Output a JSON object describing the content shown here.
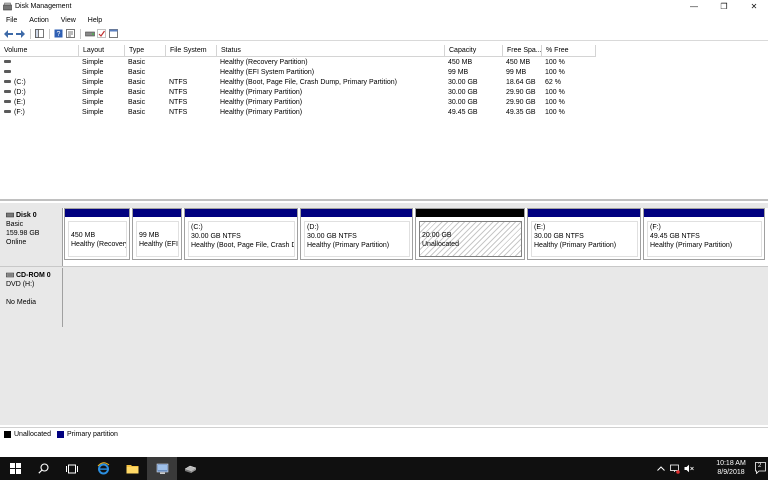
{
  "window": {
    "title": "Disk Management",
    "controls": {
      "minimize": "—",
      "restore": "❐",
      "close": "✕"
    }
  },
  "menu": [
    "File",
    "Action",
    "View",
    "Help"
  ],
  "volume_table": {
    "columns": [
      "Volume",
      "Layout",
      "Type",
      "File System",
      "Status",
      "Capacity",
      "Free Spa...",
      "% Free"
    ],
    "rows": [
      {
        "volume": "",
        "layout": "Simple",
        "type": "Basic",
        "fs": "",
        "status": "Healthy (Recovery Partition)",
        "capacity": "450 MB",
        "free": "450 MB",
        "pct": "100 %"
      },
      {
        "volume": "",
        "layout": "Simple",
        "type": "Basic",
        "fs": "",
        "status": "Healthy (EFI System Partition)",
        "capacity": "99 MB",
        "free": "99 MB",
        "pct": "100 %"
      },
      {
        "volume": "(C:)",
        "layout": "Simple",
        "type": "Basic",
        "fs": "NTFS",
        "status": "Healthy (Boot, Page File, Crash Dump, Primary Partition)",
        "capacity": "30.00 GB",
        "free": "18.64 GB",
        "pct": "62 %"
      },
      {
        "volume": "(D:)",
        "layout": "Simple",
        "type": "Basic",
        "fs": "NTFS",
        "status": "Healthy (Primary Partition)",
        "capacity": "30.00 GB",
        "free": "29.90 GB",
        "pct": "100 %"
      },
      {
        "volume": "(E:)",
        "layout": "Simple",
        "type": "Basic",
        "fs": "NTFS",
        "status": "Healthy (Primary Partition)",
        "capacity": "30.00 GB",
        "free": "29.90 GB",
        "pct": "100 %"
      },
      {
        "volume": "(F:)",
        "layout": "Simple",
        "type": "Basic",
        "fs": "NTFS",
        "status": "Healthy (Primary Partition)",
        "capacity": "49.45 GB",
        "free": "49.35 GB",
        "pct": "100 %"
      }
    ]
  },
  "disk0": {
    "name": "Disk 0",
    "type": "Basic",
    "size": "159.98 GB",
    "state": "Online",
    "partitions": [
      {
        "name": "",
        "size": "450 MB",
        "status": "Healthy (Recovery"
      },
      {
        "name": "",
        "size": "99 MB",
        "status": "Healthy (EFI S"
      },
      {
        "name": "(C:)",
        "size": "30.00 GB NTFS",
        "status": "Healthy (Boot, Page File, Crash Du"
      },
      {
        "name": "(D:)",
        "size": "30.00 GB NTFS",
        "status": "Healthy (Primary Partition)"
      },
      {
        "name": "",
        "size": "20.00 GB",
        "status": "Unallocated"
      },
      {
        "name": "(E:)",
        "size": "30.00 GB NTFS",
        "status": "Healthy (Primary Partition)"
      },
      {
        "name": "(F:)",
        "size": "49.45 GB NTFS",
        "status": "Healthy (Primary Partition)"
      }
    ]
  },
  "cdrom0": {
    "name": "CD-ROM 0",
    "type": "DVD (H:)",
    "media": "No Media"
  },
  "legend": {
    "unallocated": "Unallocated",
    "primary": "Primary partition",
    "colors": {
      "unallocated": "#000000",
      "primary": "#00007f"
    }
  },
  "taskbar": {
    "time": "10:18 AM",
    "date": "8/9/2018",
    "notification_count": "2"
  }
}
